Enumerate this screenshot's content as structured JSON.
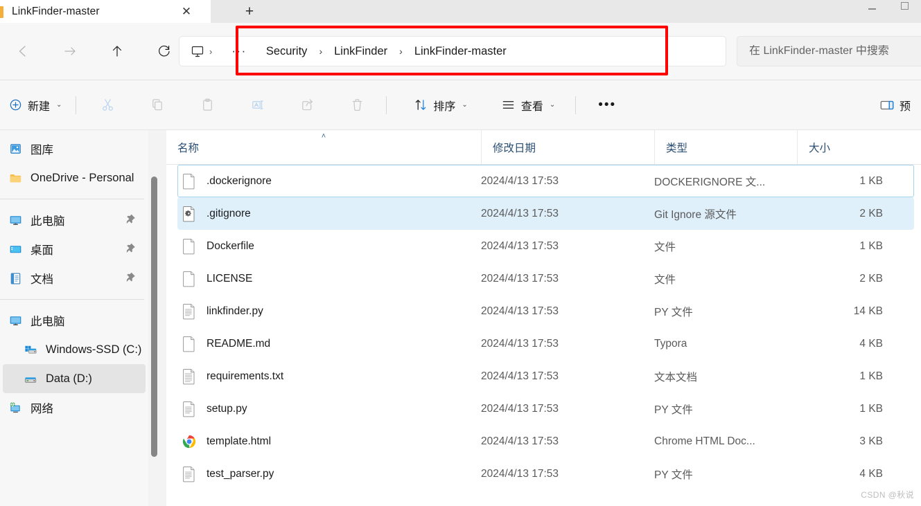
{
  "window": {
    "tab_title": "LinkFinder-master",
    "close_label": "✕",
    "newtab_label": "+",
    "minimize_label": "minimize",
    "maximize_label": "maximize"
  },
  "nav": {
    "back_label": "←",
    "forward_label": "→",
    "up_label": "↑",
    "refresh_label": "↻",
    "pc_chevron": "›",
    "overflow_dots": "···",
    "breadcrumbs": [
      {
        "label": "Security"
      },
      {
        "label": "LinkFinder"
      },
      {
        "label": "LinkFinder-master"
      }
    ],
    "separator": "›"
  },
  "search": {
    "placeholder": "在 LinkFinder-master 中搜索",
    "value": ""
  },
  "commandbar": {
    "new_label": "新建",
    "chevron": "⌄",
    "cut_name": "cut",
    "copy_name": "copy",
    "paste_name": "paste",
    "rename_name": "rename",
    "share_name": "share",
    "delete_name": "delete",
    "sort_label": "排序",
    "view_label": "查看",
    "more_dots": "•••",
    "preview_label": "预"
  },
  "sidebar": {
    "items": [
      {
        "label": "图库",
        "icon": "gallery-icon",
        "pinned": false,
        "selected": false,
        "indent": false
      },
      {
        "label": "OneDrive - Personal",
        "icon": "onedrive-folder-icon",
        "pinned": false,
        "selected": false,
        "indent": false
      },
      {
        "label": "此电脑",
        "icon": "this-pc-icon",
        "pinned": true,
        "selected": false,
        "indent": false
      },
      {
        "label": "桌面",
        "icon": "desktop-icon",
        "pinned": true,
        "selected": false,
        "indent": false
      },
      {
        "label": "文档",
        "icon": "documents-icon",
        "pinned": true,
        "selected": false,
        "indent": false
      },
      {
        "label": "此电脑",
        "icon": "this-pc-icon",
        "pinned": false,
        "selected": false,
        "indent": false
      },
      {
        "label": "Windows-SSD (C:)",
        "icon": "windows-drive-icon",
        "pinned": false,
        "selected": false,
        "indent": true
      },
      {
        "label": "Data (D:)",
        "icon": "drive-icon",
        "pinned": false,
        "selected": true,
        "indent": true
      },
      {
        "label": "网络",
        "icon": "network-icon",
        "pinned": false,
        "selected": false,
        "indent": false
      }
    ]
  },
  "filelist": {
    "columns": {
      "name": "名称",
      "date": "修改日期",
      "type": "类型",
      "size": "大小"
    },
    "sort_caret": "˄",
    "rows": [
      {
        "name": ".dockerignore",
        "date": "2024/4/13 17:53",
        "type": "DOCKERIGNORE 文...",
        "size": "1 KB",
        "icon": "blank-file-icon",
        "selected": false,
        "focused": true
      },
      {
        "name": ".gitignore",
        "date": "2024/4/13 17:53",
        "type": "Git Ignore 源文件",
        "size": "2 KB",
        "icon": "gear-file-icon",
        "selected": true,
        "focused": false
      },
      {
        "name": "Dockerfile",
        "date": "2024/4/13 17:53",
        "type": "文件",
        "size": "1 KB",
        "icon": "blank-file-icon",
        "selected": false,
        "focused": false
      },
      {
        "name": "LICENSE",
        "date": "2024/4/13 17:53",
        "type": "文件",
        "size": "2 KB",
        "icon": "blank-file-icon",
        "selected": false,
        "focused": false
      },
      {
        "name": "linkfinder.py",
        "date": "2024/4/13 17:53",
        "type": "PY 文件",
        "size": "14 KB",
        "icon": "text-file-icon",
        "selected": false,
        "focused": false
      },
      {
        "name": "README.md",
        "date": "2024/4/13 17:53",
        "type": "Typora",
        "size": "4 KB",
        "icon": "blank-file-icon",
        "selected": false,
        "focused": false
      },
      {
        "name": "requirements.txt",
        "date": "2024/4/13 17:53",
        "type": "文本文档",
        "size": "1 KB",
        "icon": "lined-file-icon",
        "selected": false,
        "focused": false
      },
      {
        "name": "setup.py",
        "date": "2024/4/13 17:53",
        "type": "PY 文件",
        "size": "1 KB",
        "icon": "text-file-icon",
        "selected": false,
        "focused": false
      },
      {
        "name": "template.html",
        "date": "2024/4/13 17:53",
        "type": "Chrome HTML Doc...",
        "size": "3 KB",
        "icon": "chrome-icon",
        "selected": false,
        "focused": false
      },
      {
        "name": "test_parser.py",
        "date": "2024/4/13 17:53",
        "type": "PY 文件",
        "size": "4 KB",
        "icon": "text-file-icon",
        "selected": false,
        "focused": false
      }
    ]
  },
  "watermark": {
    "text": "CSDN @秋说"
  },
  "colors": {
    "accent": "#0078d4",
    "highlight_box": "#fd0000",
    "selection": "#dff0fb",
    "header_text": "#2b4f73"
  }
}
